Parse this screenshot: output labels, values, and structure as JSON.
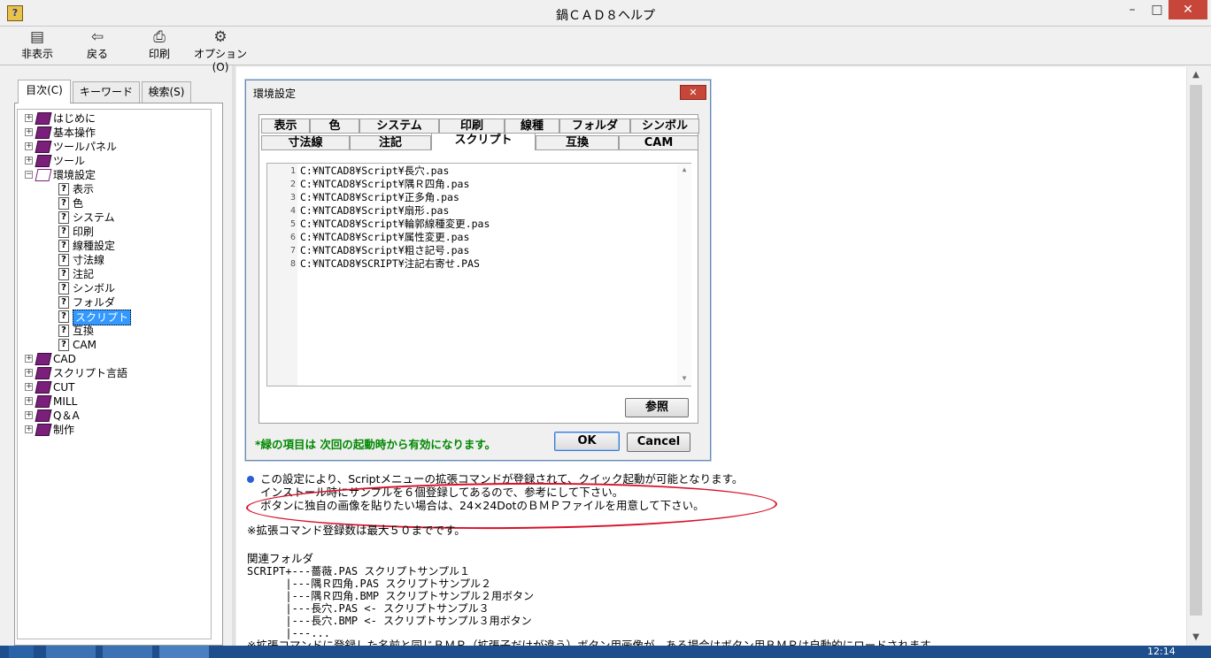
{
  "window": {
    "title": "鍋ＣＡＤ８ヘルプ",
    "icon_glyph": "?",
    "min": "–",
    "max": "□",
    "close": "✕"
  },
  "toolbar": {
    "hide": {
      "label": "非表示",
      "icon": "hide-icon"
    },
    "back": {
      "label": "戻る",
      "icon": "back-arrow-icon"
    },
    "print": {
      "label": "印刷",
      "icon": "printer-icon"
    },
    "options": {
      "label": "オプション(O)",
      "icon": "options-icon"
    }
  },
  "tabs": {
    "contents": "目次(C)",
    "keyword": "キーワード(N)",
    "search": "検索(S)"
  },
  "tree": {
    "top": [
      "はじめに",
      "基本操作",
      "ツールパネル",
      "ツール",
      "環境設定"
    ],
    "settings_children": [
      "表示",
      "色",
      "システム",
      "印刷",
      "線種設定",
      "寸法線",
      "注記",
      "シンボル",
      "フォルダ",
      "スクリプト",
      "互換",
      "CAM"
    ],
    "bottom": [
      "CAD",
      "スクリプト言語",
      "CUT",
      "MILL",
      "Q＆A",
      "制作"
    ],
    "selected": "スクリプト",
    "expand_plus": "+",
    "expand_minus": "−",
    "topic_glyph": "?"
  },
  "dialog": {
    "title": "環境設定",
    "close": "✕",
    "tabs_row1": [
      "表示",
      "色",
      "システム",
      "印刷",
      "線種",
      "フォルダ",
      "シンボル"
    ],
    "tabs_row2": [
      "寸法線",
      "注記",
      "スクリプト",
      "互換",
      "CAM"
    ],
    "active_tab": "スクリプト",
    "lines": [
      {
        "n": "1",
        "t": "C:¥NTCAD8¥Script¥長穴.pas"
      },
      {
        "n": "2",
        "t": "C:¥NTCAD8¥Script¥隅Ｒ四角.pas"
      },
      {
        "n": "3",
        "t": "C:¥NTCAD8¥Script¥正多角.pas"
      },
      {
        "n": "4",
        "t": "C:¥NTCAD8¥Script¥扇形.pas"
      },
      {
        "n": "5",
        "t": "C:¥NTCAD8¥Script¥輪郭線種変更.pas"
      },
      {
        "n": "6",
        "t": "C:¥NTCAD8¥Script¥属性変更.pas"
      },
      {
        "n": "7",
        "t": "C:¥NTCAD8¥Script¥粗さ記号.pas"
      },
      {
        "n": "8",
        "t": "C:¥NTCAD8¥SCRIPT¥注記右寄せ.PAS"
      }
    ],
    "ref_button": "参照",
    "note": "*緑の項目は 次回の起動時から有効になります。",
    "ok": "OK",
    "cancel": "Cancel"
  },
  "body": {
    "p1": "この設定により、Scriptメニューの拡張コマンドが登録されて、クイック起動が可能となります。",
    "p2": "インストール時にサンプルを６個登録してあるので、参考にして下さい。",
    "p3": "ボタンに独自の画像を貼りたい場合は、24×24DotのＢＭＰファイルを用意して下さい。",
    "p4": "※拡張コマンド登録数は最大５０までです。",
    "folder_title": "関連フォルダ",
    "folder_lines": [
      "SCRIPT+---薔薇.PAS スクリプトサンプル１",
      "      |---隅Ｒ四角.PAS スクリプトサンプル２",
      "      |---隅Ｒ四角.BMP スクリプトサンプル２用ボタン",
      "      |---長穴.PAS <- スクリプトサンプル３",
      "      |---長穴.BMP <- スクリプトサンプル３用ボタン",
      "      |---..."
    ],
    "p5": "※拡張コマンドに登録した名前と同じＢＭＰ（拡張子だけが違う）ボタン用画像が、ある場合はボタン用ＢＭＰは自動的にロードされます。"
  },
  "scroll": {
    "up": "▲",
    "down": "▼"
  },
  "clock": "12:14",
  "colors": {
    "accent": "#3399ff",
    "note_green": "#008800",
    "annotation_red": "#d8102a",
    "close_red": "#c7463a"
  }
}
